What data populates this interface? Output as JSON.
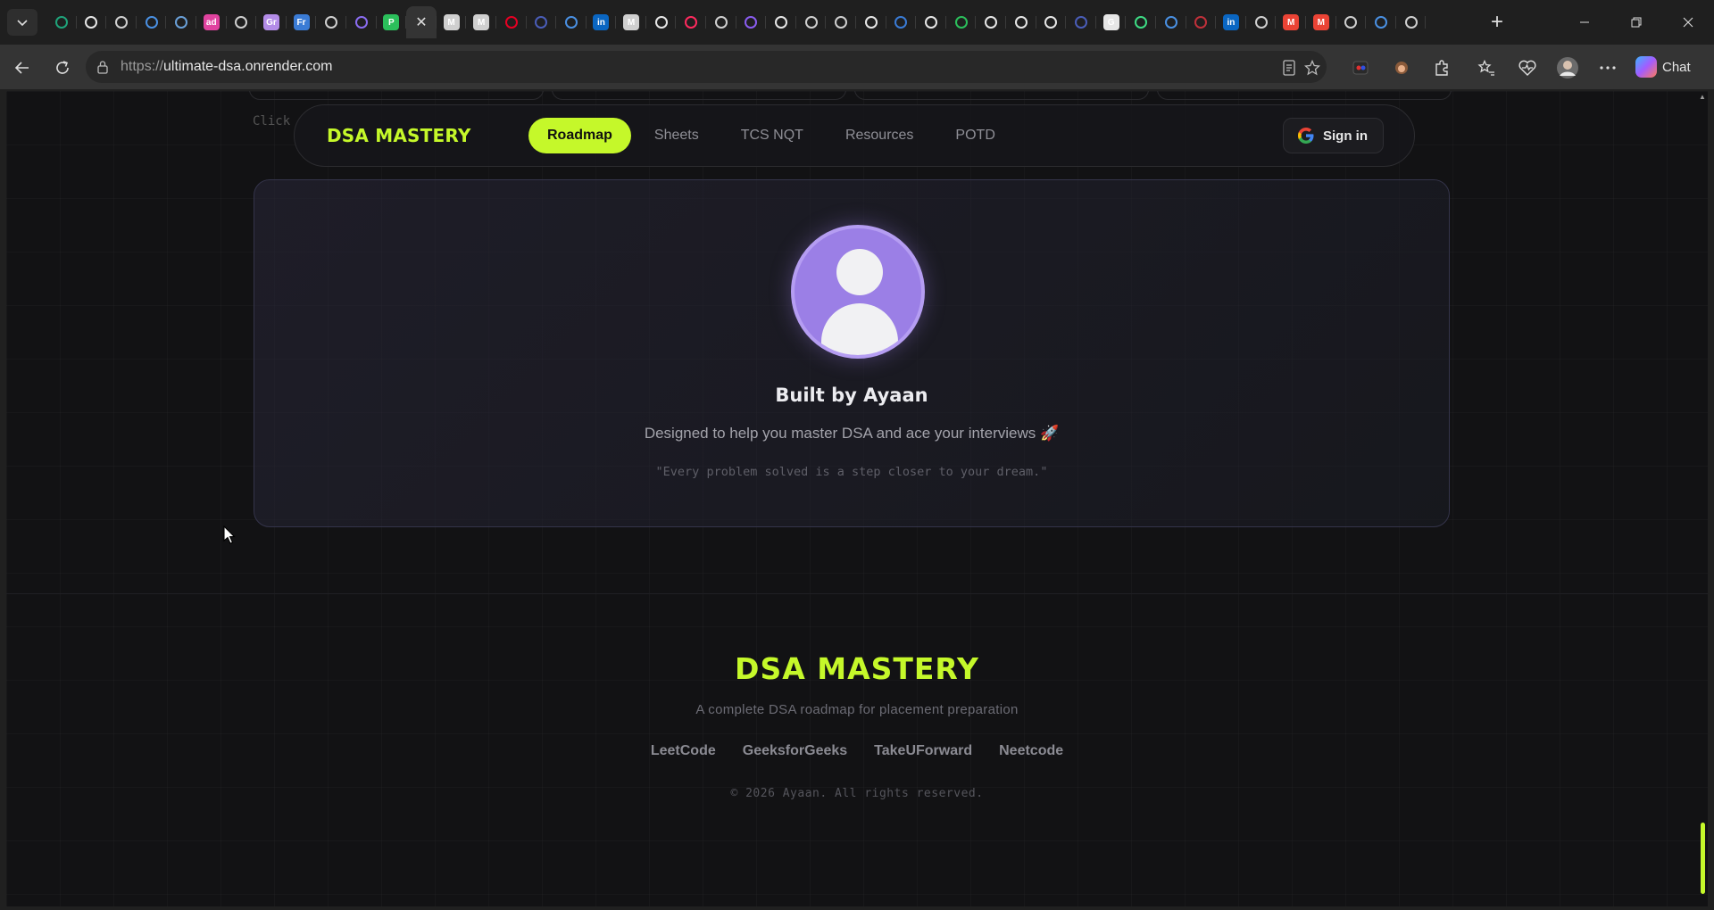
{
  "browser": {
    "tab_favicons": [
      {
        "icon": "diamond-icon",
        "color": "#1fa37a",
        "text": ""
      },
      {
        "icon": "github-icon",
        "color": "#e6e6e6",
        "text": ""
      },
      {
        "icon": "globe-icon",
        "color": "#cfcfcf",
        "text": ""
      },
      {
        "icon": "search-icon",
        "color": "#4a90e2",
        "text": ""
      },
      {
        "icon": "cloud-icon",
        "color": "#6aa0d8",
        "text": ""
      },
      {
        "icon": "ad-icon",
        "color": "#e0439f",
        "text": "ad"
      },
      {
        "icon": "tool-icon",
        "color": "#cfcfcf",
        "text": ""
      },
      {
        "icon": "gr-icon",
        "color": "#b38ce8",
        "text": "Gr"
      },
      {
        "icon": "fr-icon",
        "color": "#3a7bd5",
        "text": "Fr"
      },
      {
        "icon": "video-icon",
        "color": "#d0d0d0",
        "text": ""
      },
      {
        "icon": "app-icon",
        "color": "#8a6cf0",
        "text": ""
      },
      {
        "icon": "p-icon",
        "color": "#2bbf5b",
        "text": "P"
      },
      {
        "icon": "close-icon",
        "color": "#dddddd",
        "text": ""
      },
      {
        "icon": "medium-icon",
        "color": "#cfcfcf",
        "text": "M"
      },
      {
        "icon": "medium-icon",
        "color": "#cfcfcf",
        "text": "M"
      },
      {
        "icon": "pinterest-icon",
        "color": "#e60023",
        "text": ""
      },
      {
        "icon": "mail-icon",
        "color": "#4a5db8",
        "text": ""
      },
      {
        "icon": "search-icon",
        "color": "#4a90e2",
        "text": ""
      },
      {
        "icon": "linkedin-icon",
        "color": "#0a66c2",
        "text": "in"
      },
      {
        "icon": "medium-icon",
        "color": "#cfcfcf",
        "text": "M"
      },
      {
        "icon": "vercel-icon",
        "color": "#e6e6e6",
        "text": ""
      },
      {
        "icon": "youtube-icon",
        "color": "#ff2a5e",
        "text": ""
      },
      {
        "icon": "globe-icon",
        "color": "#cfcfcf",
        "text": ""
      },
      {
        "icon": "bolt-icon",
        "color": "#8a5cf0",
        "text": ""
      },
      {
        "icon": "vercel-icon",
        "color": "#e6e6e6",
        "text": ""
      },
      {
        "icon": "globe-icon",
        "color": "#cfcfcf",
        "text": ""
      },
      {
        "icon": "globe-icon",
        "color": "#cfcfcf",
        "text": ""
      },
      {
        "icon": "github-icon",
        "color": "#e6e6e6",
        "text": ""
      },
      {
        "icon": "edge-icon",
        "color": "#3a7bd5",
        "text": ""
      },
      {
        "icon": "github-icon",
        "color": "#e6e6e6",
        "text": ""
      },
      {
        "icon": "leaf-icon",
        "color": "#2bbf5b",
        "text": ""
      },
      {
        "icon": "vercel-icon",
        "color": "#e6e6e6",
        "text": ""
      },
      {
        "icon": "link-icon",
        "color": "#e6e6e6",
        "text": ""
      },
      {
        "icon": "link-icon",
        "color": "#e6e6e6",
        "text": ""
      },
      {
        "icon": "app-icon",
        "color": "#4a5db8",
        "text": ""
      },
      {
        "icon": "google-icon",
        "color": "#e6e6e6",
        "text": "G"
      },
      {
        "icon": "android-icon",
        "color": "#3ddc84",
        "text": ""
      },
      {
        "icon": "search-icon",
        "color": "#4a90e2",
        "text": ""
      },
      {
        "icon": "app-icon",
        "color": "#c0303a",
        "text": ""
      },
      {
        "icon": "linkedin-icon",
        "color": "#0a66c2",
        "text": "in"
      },
      {
        "icon": "calendar-icon",
        "color": "#cfcfcf",
        "text": ""
      },
      {
        "icon": "gmail-icon",
        "color": "#ea4335",
        "text": "M"
      },
      {
        "icon": "gmail-icon",
        "color": "#ea4335",
        "text": "M"
      },
      {
        "icon": "globe-icon",
        "color": "#cfcfcf",
        "text": ""
      },
      {
        "icon": "loading-icon",
        "color": "#4a90e2",
        "text": ""
      },
      {
        "icon": "globe-icon",
        "color": "#cfcfcf",
        "text": ""
      }
    ],
    "address": {
      "protocol": "https://",
      "host": "ultimate-dsa.onrender.com"
    },
    "chat_label": "Chat"
  },
  "page": {
    "click_hint": "Click",
    "nav": {
      "brand": "DSA MASTERY",
      "links": [
        "Roadmap",
        "Sheets",
        "TCS NQT",
        "Resources",
        "POTD"
      ],
      "active_link": "Roadmap",
      "sign_in": "Sign in"
    },
    "about": {
      "title": "Built by Ayaan",
      "tagline": "Designed to help you master DSA and ace your interviews 🚀",
      "quote": "\"Every problem solved is a step closer to your dream.\""
    },
    "footer": {
      "brand": "DSA MASTERY",
      "description": "A complete DSA roadmap for placement preparation",
      "links": [
        "LeetCode",
        "GeeksforGeeks",
        "TakeUForward",
        "Neetcode"
      ],
      "copyright": "© 2026 Ayaan. All rights reserved."
    }
  },
  "colors": {
    "accent": "#c5f82a",
    "avatar": "#9b7fe6",
    "page_bg": "#121214"
  }
}
